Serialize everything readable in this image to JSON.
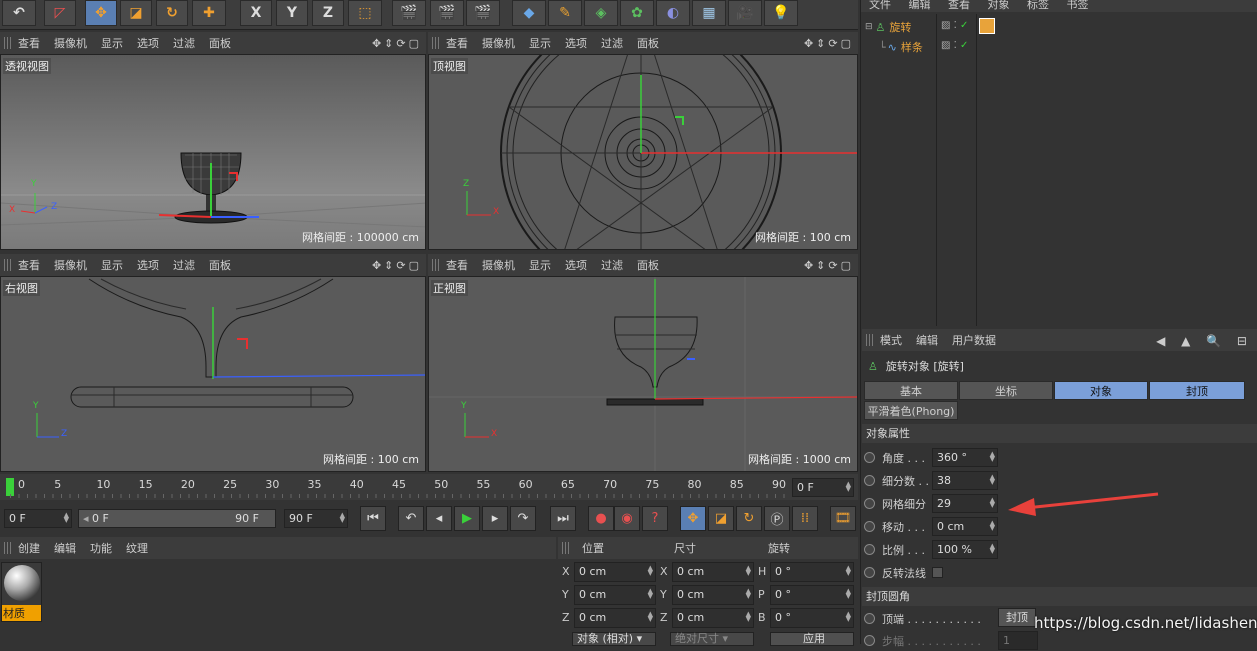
{
  "toolbar": {
    "icons": [
      "undo-icon",
      "select-icon",
      "move-icon",
      "scale-icon",
      "rotate-icon",
      "transform-icon",
      "x-axis-icon",
      "y-axis-icon",
      "z-axis-icon",
      "coordinate-system-icon",
      "render-view-icon",
      "render-picture-queue-icon",
      "edit-render-settings-icon",
      "cube-icon",
      "pen-icon",
      "subdivision-icon",
      "array-icon",
      "deformer-icon",
      "floor-icon",
      "camera-icon",
      "light-icon"
    ],
    "axis_x": "X",
    "axis_y": "Y",
    "axis_z": "Z"
  },
  "viewport_menu": [
    "查看",
    "摄像机",
    "显示",
    "选项",
    "过滤",
    "面板"
  ],
  "viewports": [
    {
      "name": "透视视图",
      "grid": "网格间距 : 100000 cm"
    },
    {
      "name": "顶视图",
      "grid": "网格间距 : 100 cm"
    },
    {
      "name": "右视图",
      "grid": "网格间距 : 100 cm"
    },
    {
      "name": "正视图",
      "grid": "网格间距 : 1000 cm"
    }
  ],
  "axes": {
    "x": "X",
    "y": "Y",
    "z": "Z"
  },
  "object_manager": {
    "menu": [
      "文件",
      "编辑",
      "查看",
      "对象",
      "标签",
      "书签"
    ],
    "objects": [
      {
        "name": "旋转",
        "color": "#e8a33a"
      },
      {
        "name": "样条",
        "color": "#e8a33a"
      }
    ]
  },
  "timeline": {
    "ticks": [
      "0",
      "5",
      "10",
      "15",
      "20",
      "25",
      "30",
      "35",
      "40",
      "45",
      "50",
      "55",
      "60",
      "65",
      "70",
      "75",
      "80",
      "85",
      "90"
    ],
    "current_frame": "0 F",
    "start": "0 F",
    "range_start": "0 F",
    "range_end": "90 F",
    "end": "90 F"
  },
  "material_manager": {
    "menu": [
      "创建",
      "编辑",
      "功能",
      "纹理"
    ],
    "material": "材质"
  },
  "coord_manager": {
    "headers": [
      "位置",
      "尺寸",
      "旋转"
    ],
    "rows": [
      {
        "a": "X",
        "pos": "0 cm",
        "b": "X",
        "size": "0 cm",
        "c": "H",
        "rot": "0 °"
      },
      {
        "a": "Y",
        "pos": "0 cm",
        "b": "Y",
        "size": "0 cm",
        "c": "P",
        "rot": "0 °"
      },
      {
        "a": "Z",
        "pos": "0 cm",
        "b": "Z",
        "size": "0 cm",
        "c": "B",
        "rot": "0 °"
      }
    ],
    "mode": "对象 (相对)",
    "size_mode": "绝对尺寸",
    "apply": "应用"
  },
  "attr_manager": {
    "menu": [
      "模式",
      "编辑",
      "用户数据"
    ],
    "title": "旋转对象 [旋转]",
    "tabs": [
      "基本",
      "坐标",
      "对象",
      "封顶"
    ],
    "phong": "平滑着色(Phong)",
    "section": "对象属性",
    "props": [
      {
        "label": "角度 . . .",
        "value": "360 °"
      },
      {
        "label": "细分数 . .",
        "value": "38"
      },
      {
        "label": "网格细分",
        "value": "29"
      },
      {
        "label": "移动 . . .",
        "value": "0 cm"
      },
      {
        "label": "比例 . . .",
        "value": "100 %"
      }
    ],
    "flip_normals": "反转法线",
    "cap_section": "封顶圆角",
    "cap_label": "顶端 . . . . . . . . . . .",
    "cap_value": "封顶",
    "steps_label": "步幅 . . . . . . . . . . .",
    "steps_value": "1"
  },
  "watermark": "https://blog.csdn.net/lidashent",
  "colors": {
    "accent": "#5a7fb3",
    "annotation": "#e8413b",
    "material_label": "#f0a000"
  }
}
